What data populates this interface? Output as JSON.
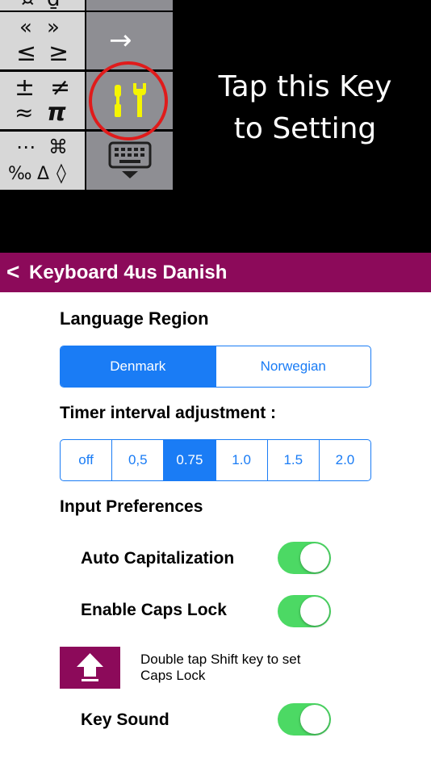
{
  "keyboard": {
    "keys": [
      {
        "name": "key-currency",
        "symbols": [
          "¤",
          "₫"
        ]
      },
      {
        "name": "key-guillemets-compare",
        "symbols": [
          "«",
          "»",
          "≤",
          "≥"
        ]
      },
      {
        "name": "key-math",
        "symbols": [
          "±",
          "≠",
          "≈",
          "π"
        ]
      },
      {
        "name": "key-misc",
        "symbols": [
          "⋯",
          "⌘",
          "‰",
          "Δ",
          "◊"
        ]
      }
    ],
    "arrow": "→",
    "keyboard_glyph": "⌨"
  },
  "callout": {
    "line1": "Tap this Key",
    "line2": "to Setting"
  },
  "navbar": {
    "back": "<",
    "title": "Keyboard 4us Danish",
    "color": "#8c0a5a"
  },
  "language_region": {
    "heading": "Language Region",
    "options": [
      "Denmark",
      "Norwegian"
    ],
    "selected": "Denmark"
  },
  "timer": {
    "heading": "Timer interval adjustment :",
    "options": [
      "off",
      "0,5",
      "0.75",
      "1.0",
      "1.5",
      "2.0"
    ],
    "selected": "0.75"
  },
  "input_preferences": {
    "heading": "Input Preferences",
    "auto_capitalization": {
      "label": "Auto Capitalization",
      "on": true
    },
    "caps_lock": {
      "label": "Enable Caps Lock",
      "on": true
    },
    "caps_hint": "Double tap Shift key to set Caps Lock",
    "key_sound": {
      "label": "Key Sound",
      "on": true
    }
  },
  "colors": {
    "accent_blue": "#1a7cf5",
    "toggle_green": "#4cd964",
    "highlight_red": "#e01b1b",
    "tool_yellow": "#f5f500"
  }
}
